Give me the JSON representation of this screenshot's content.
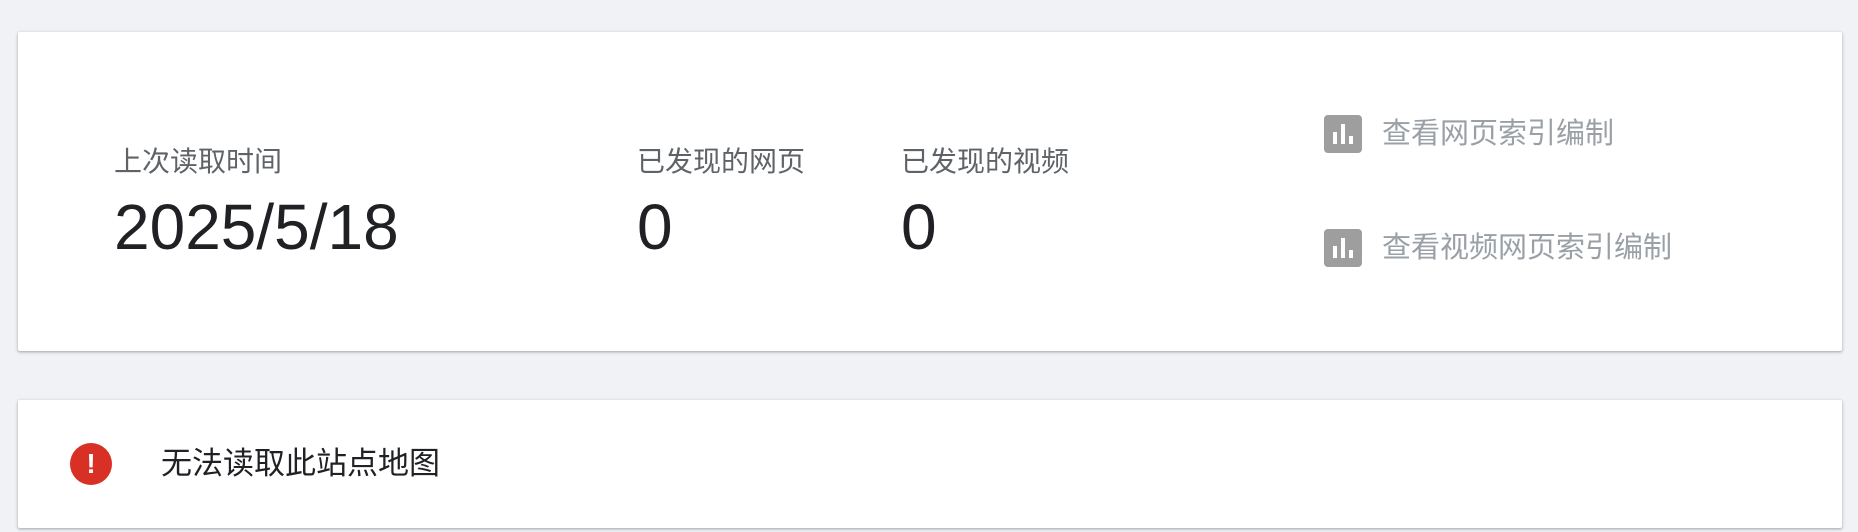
{
  "stats": {
    "last_read": {
      "label": "上次读取时间",
      "value": "2025/5/18"
    },
    "discovered_pages": {
      "label": "已发现的网页",
      "value": "0"
    },
    "discovered_videos": {
      "label": "已发现的视频",
      "value": "0"
    }
  },
  "report_links": [
    {
      "label": "查看网页索引编制",
      "icon": "bar-chart-icon"
    },
    {
      "label": "查看视频网页索引编制",
      "icon": "bar-chart-icon"
    }
  ],
  "error": {
    "message": "无法读取此站点地图",
    "icon": "error-icon",
    "icon_glyph": "!",
    "color": "#d93025"
  },
  "colors": {
    "background": "#f0f2f6",
    "card": "#ffffff",
    "link_text": "#9aa0a6",
    "icon_gray": "#9e9e9e",
    "error_red": "#d93025"
  }
}
